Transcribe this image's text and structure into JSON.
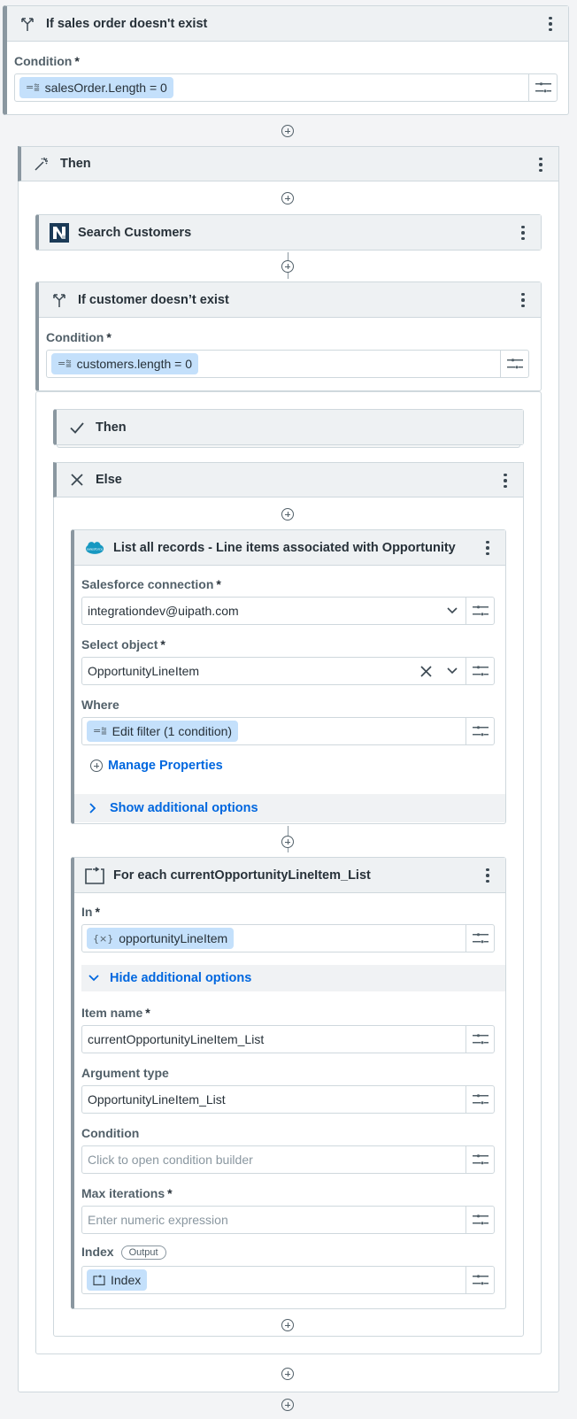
{
  "if_sales": {
    "title": "If sales order doesn't exist",
    "condition_label": "Condition",
    "condition_value": "salesOrder.Length = 0"
  },
  "then_outer": {
    "title": "Then"
  },
  "search_customers": {
    "title": "Search Customers"
  },
  "if_customer": {
    "title": "If customer doesn’t exist",
    "condition_label": "Condition",
    "condition_value": "customers.length = 0"
  },
  "then_inner": {
    "title": "Then"
  },
  "else_block": {
    "title": "Else"
  },
  "list_records": {
    "title": "List all records - Line items associated with Opportunity",
    "connection_label": "Salesforce connection",
    "connection_value": "integrationdev@uipath.com",
    "object_label": "Select object",
    "object_value": "OpportunityLineItem",
    "where_label": "Where",
    "where_value": "Edit filter (1 condition)",
    "manage_properties": "Manage Properties",
    "show_options": "Show additional options"
  },
  "for_each": {
    "title": "For each currentOpportunityLineItem_List",
    "in_label": "In",
    "in_value": "opportunityLineItem",
    "hide_options": "Hide additional options",
    "item_name_label": "Item name",
    "item_name_value": "currentOpportunityLineItem_List",
    "arg_type_label": "Argument type",
    "arg_type_value": "OpportunityLineItem_List",
    "condition_label": "Condition",
    "condition_placeholder": "Click to open condition builder",
    "max_iter_label": "Max iterations",
    "max_iter_placeholder": "Enter numeric expression",
    "index_label": "Index",
    "index_tag": "Output",
    "index_value": "Index"
  },
  "required_mark": "*",
  "colors": {
    "accent": "#0067df",
    "chip": "#c4e0fb",
    "border": "#cfd8dd",
    "card_bar": "#8a97a0"
  }
}
